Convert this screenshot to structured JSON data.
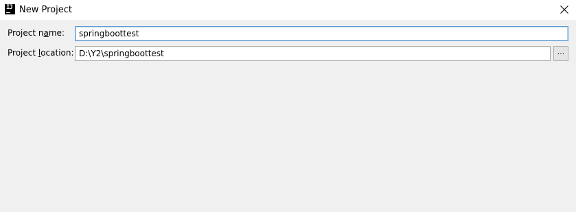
{
  "window": {
    "title": "New Project",
    "icon": "intellij-idea-icon",
    "icon_text": "IJ",
    "close_icon": "close-icon"
  },
  "form": {
    "project_name": {
      "label_before": "Project n",
      "label_mnemonic": "a",
      "label_after": "me:",
      "value": "springboottest"
    },
    "project_location": {
      "label_before": "Project ",
      "label_mnemonic": "l",
      "label_after": "ocation:",
      "value": "D:\\Y2\\springboottest"
    },
    "browse_button_label": "..."
  },
  "colors": {
    "titlebar_bg": "#ffffff",
    "dialog_bg": "#f0f0f0",
    "focus_border": "#5b9bd5",
    "field_border": "#a6a6a6"
  }
}
